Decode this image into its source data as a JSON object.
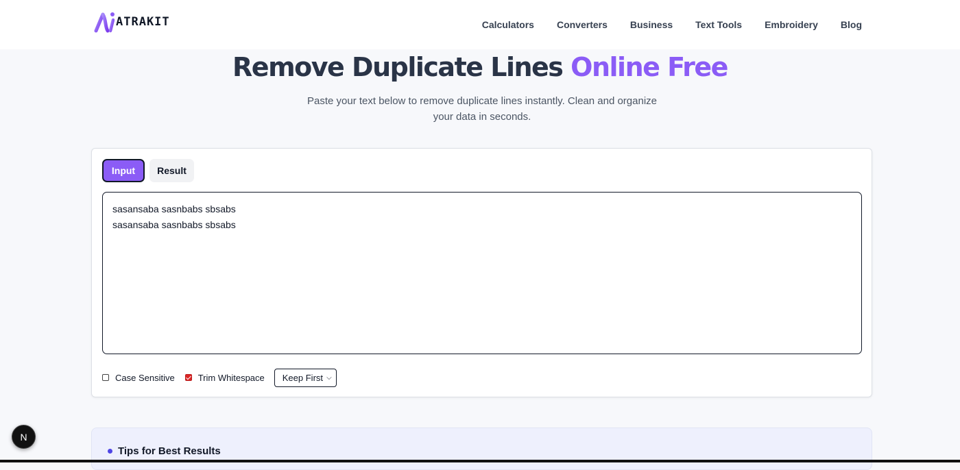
{
  "brand": {
    "name": "ATRAKIT",
    "accent_color": "#8b5cf6"
  },
  "nav": {
    "items": [
      {
        "label": "Calculators"
      },
      {
        "label": "Converters"
      },
      {
        "label": "Business"
      },
      {
        "label": "Text Tools"
      },
      {
        "label": "Embroidery"
      },
      {
        "label": "Blog"
      }
    ]
  },
  "hero": {
    "title_main": "Remove Duplicate Lines",
    "title_accent": "Online Free",
    "subtitle": "Paste your text below to remove duplicate lines instantly. Clean and organize your data in seconds."
  },
  "tool": {
    "tabs": [
      {
        "label": "Input",
        "active": true
      },
      {
        "label": "Result",
        "active": false
      }
    ],
    "input_text": "sasansaba sasnbabs sbsabs\nsasansaba sasnbabs sbsabs",
    "options": {
      "case_sensitive": {
        "label": "Case Sensitive",
        "checked": false
      },
      "trim_whitespace": {
        "label": "Trim Whitespace",
        "checked": true
      },
      "keep_mode": {
        "selected": "Keep First"
      }
    }
  },
  "tips": {
    "title": "Tips for Best Results"
  },
  "dev_badge": {
    "letter": "N",
    "icon": "nextjs-icon"
  }
}
